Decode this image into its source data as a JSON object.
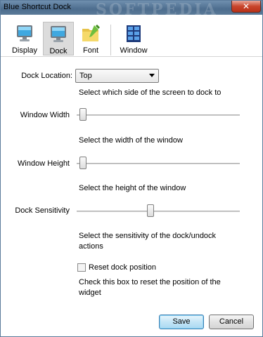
{
  "window": {
    "title": "Blue Shortcut Dock",
    "watermark": "SOFTPEDIA",
    "close_label": "✕"
  },
  "toolbar": {
    "items": [
      {
        "label": "Display",
        "icon": "monitor-icon",
        "active": false
      },
      {
        "label": "Dock",
        "icon": "dock-monitor-icon",
        "active": true
      },
      {
        "label": "Font",
        "icon": "font-folder-icon",
        "active": false
      },
      {
        "label": "Window",
        "icon": "window-grid-icon",
        "active": false
      }
    ]
  },
  "form": {
    "dock_location": {
      "label": "Dock Location:",
      "value": "Top",
      "description": "Select which side of the screen to dock to"
    },
    "window_width": {
      "label": "Window Width",
      "description": "Select the width of the window",
      "slider_fraction": 0.02
    },
    "window_height": {
      "label": "Window Height",
      "description": "Select the height of the window",
      "slider_fraction": 0.02
    },
    "dock_sensitivity": {
      "label": "Dock Sensitivity",
      "description_line1": "Select the sensitivity of the dock/undock",
      "description_line2": "actions",
      "slider_fraction": 0.45
    },
    "reset": {
      "label": "Reset dock position",
      "checked": false,
      "description_line1": "Check this box to reset the position of the",
      "description_line2": "widget"
    }
  },
  "buttons": {
    "save": "Save",
    "cancel": "Cancel"
  }
}
